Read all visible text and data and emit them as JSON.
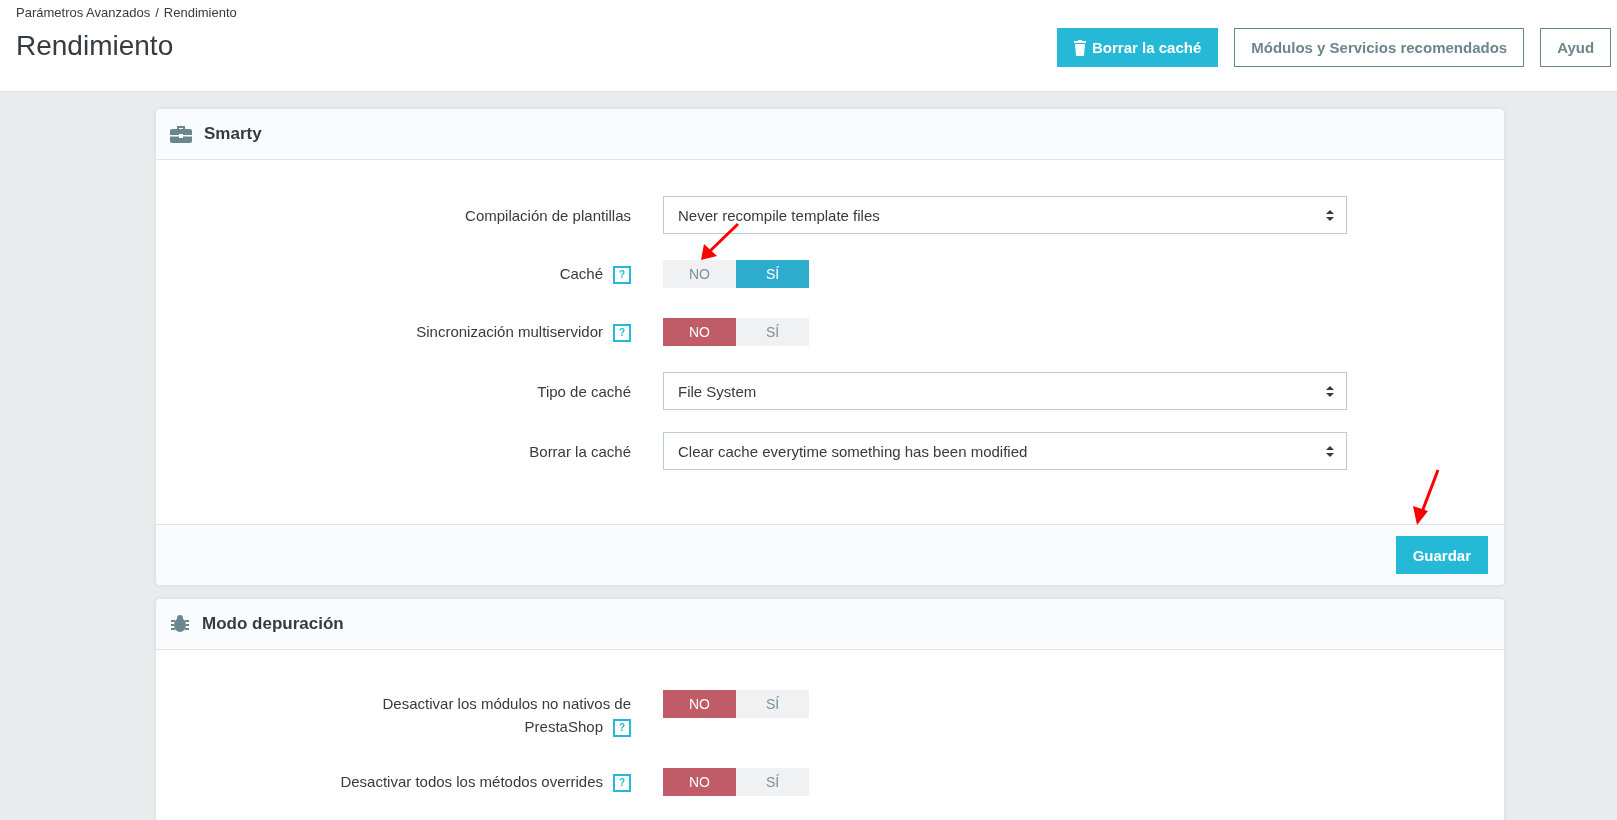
{
  "breadcrumb": [
    "Parámetros Avanzados",
    "Rendimiento"
  ],
  "breadcrumb_separator": "/",
  "page_title": "Rendimiento",
  "toolbar_buttons": [
    {
      "label": "Borrar la caché",
      "kind": "primary"
    },
    {
      "label": "Módulos y Servicios recomendados",
      "kind": "outline"
    },
    {
      "label": "Ayud",
      "kind": "outline"
    }
  ],
  "panels": [
    {
      "title": "Smarty",
      "fields": [
        {
          "kind": "select",
          "label": "Compilación de plantillas",
          "value": "Never recompile template files"
        },
        {
          "kind": "switch",
          "label": "Caché",
          "help": "?",
          "options": [
            {
              "label": "NO",
              "selected": false
            },
            {
              "label": "SÍ",
              "selected": true
            }
          ]
        },
        {
          "kind": "switch",
          "label": "Sincronización multiservidor",
          "help": "?",
          "options": [
            {
              "label": "NO",
              "selected": true
            },
            {
              "label": "SÍ",
              "selected": false
            }
          ]
        },
        {
          "kind": "select",
          "label": "Tipo de caché",
          "value": "File System"
        },
        {
          "kind": "select",
          "label": "Borrar la caché",
          "value": "Clear cache everytime something has been modified"
        }
      ],
      "save_button": "Guardar"
    },
    {
      "title": "Modo depuración",
      "fields": [
        {
          "kind": "switch",
          "label": "Desactivar los módulos no nativos de PrestaShop",
          "help": "?",
          "options": [
            {
              "label": "NO",
              "selected": true
            },
            {
              "label": "SÍ",
              "selected": false
            }
          ]
        },
        {
          "kind": "switch",
          "label": "Desactivar todos los métodos overrides",
          "help": "?",
          "options": [
            {
              "label": "NO",
              "selected": true
            },
            {
              "label": "SÍ",
              "selected": false
            }
          ]
        }
      ]
    }
  ]
}
